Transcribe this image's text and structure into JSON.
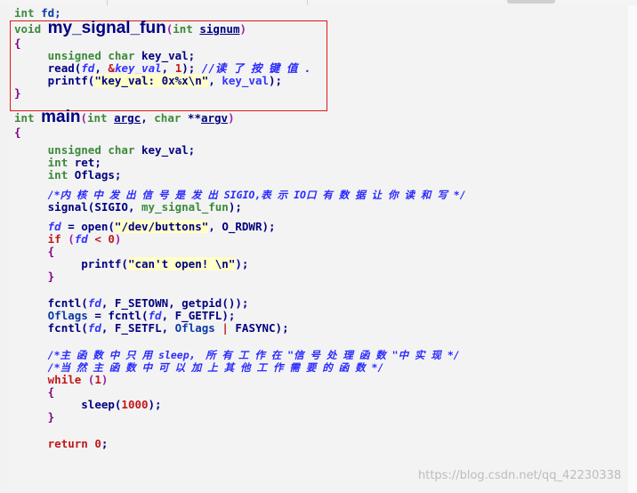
{
  "code_lines": {
    "l01": {
      "a": "int ",
      "b": "fd;"
    },
    "l02": {
      "kw": "void ",
      "fn": "my_signal_fun",
      "open": "(",
      "type": "int ",
      "param": "signum",
      "close": ")"
    },
    "l03": "{",
    "l04": {
      "indent": "     ",
      "type": "unsigned char ",
      "name": "key_val;"
    },
    "l05": {
      "indent": "     ",
      "fn": "read(",
      "v1": "fd",
      "c1": ", ",
      "amp": "&",
      "v2": "key_val",
      "c2": ", ",
      "num": "1",
      "end": "); ",
      "cm": "//读 了 按 键 值 ."
    },
    "l06": {
      "indent": "     ",
      "fn": "printf(",
      "str": "\"key_val: 0x%x\\n\"",
      "c": ", ",
      "v": "key_val",
      "end": ");"
    },
    "l07": "}",
    "l08": {
      "type": "int ",
      "fn": "main",
      "open": "(",
      "t1": "int ",
      "p1": "argc",
      "c": ", ",
      "t2": "char ",
      "st": "**",
      "p2": "argv",
      "close": ")"
    },
    "l09": "{",
    "l10": {
      "indent": "     ",
      "type": "unsigned char ",
      "name": "key_val;"
    },
    "l11": {
      "indent": "     ",
      "type": "int ",
      "name": "ret;"
    },
    "l12": {
      "indent": "     ",
      "type": "int ",
      "name": "Oflags;"
    },
    "l13": {
      "indent": "     ",
      "cm": "/*内 核 中 发 出 信 号 是 发 出 SIGIO,表 示 IO口 有 数 据 让 你 读 和 写 */"
    },
    "l14": {
      "indent": "     ",
      "text": "signal(SIGIO, ",
      "fn": "my_signal_fun",
      "end": ");"
    },
    "l15": {
      "indent": "     ",
      "v": "fd",
      "eq": " = ",
      "fn": "open(",
      "str": "\"/dev/buttons\"",
      "rest": ", O_RDWR);"
    },
    "l16": {
      "indent": "     ",
      "kw": "if ",
      "open": "(",
      "v": "fd",
      "op": " < ",
      "num": "0",
      "close": ")"
    },
    "l17": {
      "indent": "     ",
      "text": "{"
    },
    "l18": {
      "indent": "          ",
      "fn": "printf(",
      "str": "\"can't open! \\n\"",
      "end": ");"
    },
    "l19": {
      "indent": "     ",
      "text": "}"
    },
    "l20": {
      "indent": "     ",
      "fn": "fcntl(",
      "v": "fd",
      "rest": ", F_SETOWN, getpid());"
    },
    "l21": {
      "indent": "     ",
      "name": "Oflags",
      "eq": " = ",
      "fn": "fcntl(",
      "v": "fd",
      "rest": ", F_GETFL);"
    },
    "l22": {
      "indent": "     ",
      "fn": "fcntl(",
      "v": "fd",
      "rest1": ", F_SETFL, ",
      "name": "Oflags",
      "pipe": " | ",
      "rest2": "FASYNC);"
    },
    "l23": {
      "indent": "     ",
      "cm": "/*主 函 数 中 只 用 sleep， 所 有 工 作 在 \"信 号 处 理 函 数 \"中 实 现 */"
    },
    "l24": {
      "indent": "     ",
      "cm": "/*当 然 主 函 数 中 可 以 加 上 其 他 工 作 需 要 的 函 数 */"
    },
    "l25": {
      "indent": "     ",
      "kw": "while ",
      "open": "(",
      "num": "1",
      "close": ")"
    },
    "l26": {
      "indent": "     ",
      "text": "{"
    },
    "l27": {
      "indent": "          ",
      "fn": "sleep(",
      "num": "1000",
      "end": ");"
    },
    "l28": {
      "indent": "     ",
      "text": "}"
    },
    "l29": {
      "indent": "     ",
      "kw": "return ",
      "num": "0",
      "end": ";"
    }
  },
  "watermark": "https://blog.csdn.net/qq_42230338",
  "colors": {
    "keyword": "#3c8a3c",
    "function": "#000080",
    "number": "#c0181a",
    "string_bg": "#ffffc8",
    "comment": "#2a2aff",
    "highlight_box": "#e01818"
  }
}
